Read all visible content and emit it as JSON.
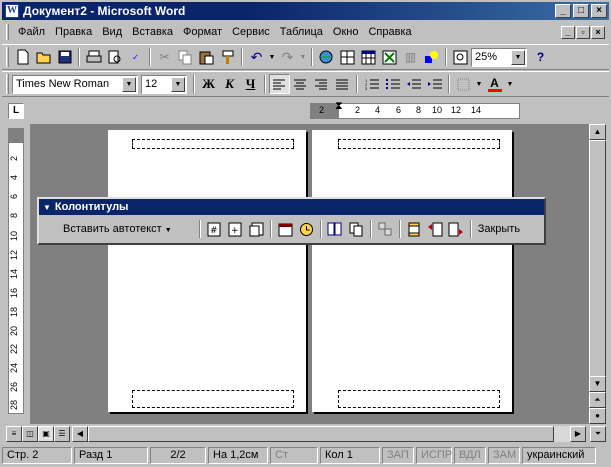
{
  "window": {
    "title": "Документ2 - Microsoft Word",
    "app_icon": "W"
  },
  "menu": [
    "Файл",
    "Правка",
    "Вид",
    "Вставка",
    "Формат",
    "Сервис",
    "Таблица",
    "Окно",
    "Справка"
  ],
  "standard_toolbar": {
    "zoom_value": "25%"
  },
  "format_toolbar": {
    "font_name": "Times New Roman",
    "font_size": "12",
    "bold_label": "Ж",
    "italic_label": "К",
    "underline_label": "Ч",
    "font_color_label": "A",
    "font_color": "#ff0000"
  },
  "ruler": {
    "corner_label": "L",
    "horizontal_ticks": [
      "2",
      "2",
      "4",
      "6",
      "8",
      "10",
      "12",
      "14"
    ],
    "vertical_ticks": [
      "2",
      "4",
      "6",
      "8",
      "10",
      "12",
      "14",
      "16",
      "18",
      "20",
      "22",
      "24",
      "26",
      "28"
    ]
  },
  "hf_toolbar": {
    "title": "Колонтитулы",
    "insert_autotext_label": "Вставить автотекст",
    "close_label": "Закрыть"
  },
  "status": {
    "page": "Стр. 2",
    "section": "Разд 1",
    "pages": "2/2",
    "at": "На 1,2см",
    "line": "Ст",
    "col": "Кол 1",
    "rec": "ЗАП",
    "trk": "ИСПР",
    "ext": "ВДЛ",
    "ovr": "ЗАМ",
    "language": "украинский"
  }
}
